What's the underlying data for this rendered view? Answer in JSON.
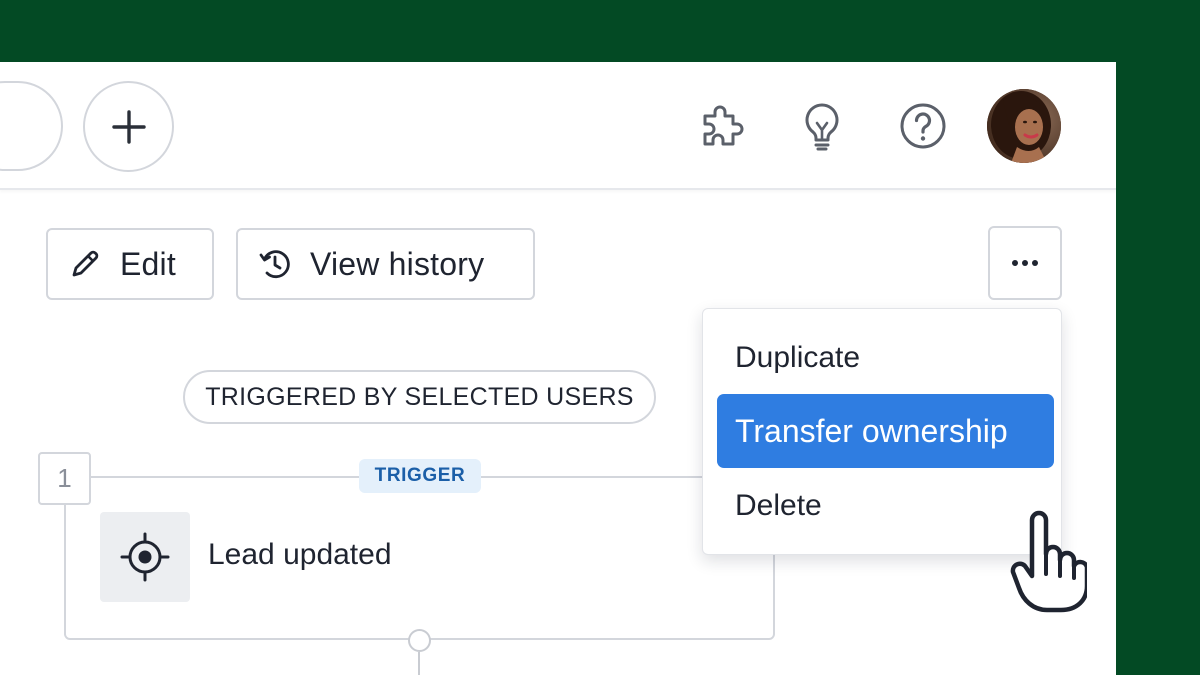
{
  "toolbar": {
    "edit_label": "Edit",
    "history_label": "View history"
  },
  "flow": {
    "trigger_banner": "TRIGGERED BY SELECTED USERS",
    "step": {
      "number": "1",
      "tag": "TRIGGER",
      "title": "Lead updated",
      "icon": "target-icon"
    }
  },
  "menu": {
    "items": [
      {
        "label": "Duplicate",
        "selected": false
      },
      {
        "label": "Transfer ownership",
        "selected": true
      },
      {
        "label": "Delete",
        "selected": false
      }
    ]
  },
  "header_icons": [
    "plus-icon",
    "puzzle-icon",
    "lightbulb-icon",
    "help-icon",
    "avatar"
  ],
  "colors": {
    "frame": "#034a24",
    "accent": "#2f7de1",
    "tag_bg": "#e4f0fb",
    "tag_text": "#1b5fa8"
  }
}
